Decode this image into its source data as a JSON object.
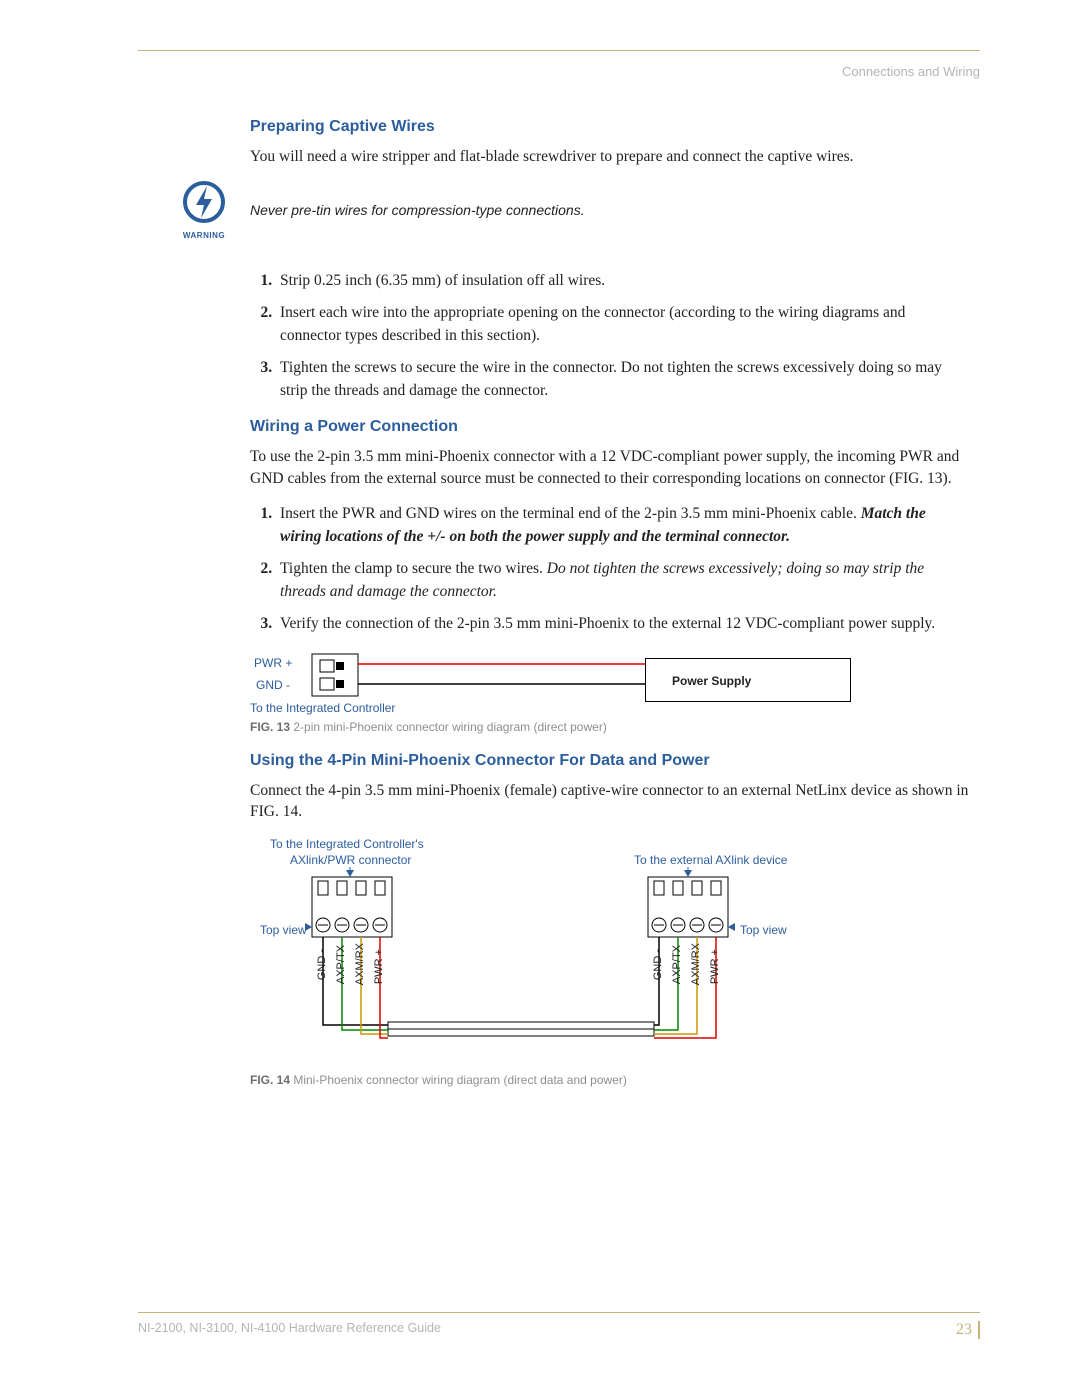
{
  "header": {
    "section": "Connections and Wiring"
  },
  "s1": {
    "title": "Preparing Captive Wires",
    "intro": "You will need a wire stripper and flat-blade screwdriver to prepare and connect the captive wires.",
    "warning_label": "WARNING",
    "warning_text": "Never pre-tin wires for compression-type connections.",
    "step1": "Strip 0.25 inch (6.35 mm) of insulation off all wires.",
    "step2": "Insert each wire into the appropriate opening on the connector (according to the wiring diagrams and connector types described in this section).",
    "step3": "Tighten the screws to secure the wire in the connector. Do not tighten the screws excessively doing so may strip the threads and damage the connector."
  },
  "s2": {
    "title": "Wiring a Power Connection",
    "intro": "To use the 2-pin 3.5 mm mini-Phoenix connector with a 12 VDC-compliant power supply, the incoming PWR and GND cables from the external source must be connected to their corresponding locations on connector (FIG. 13).",
    "step1a": "Insert the PWR and GND wires on the terminal end of the 2-pin 3.5 mm mini-Phoenix cable. ",
    "step1b": "Match the wiring locations of the +/- on both the power supply and the terminal connector.",
    "step2a": "Tighten the clamp to secure the two wires. ",
    "step2b": "Do not tighten the screws excessively; doing so may strip the threads and damage the connector.",
    "step3": "Verify the connection of the 2-pin 3.5 mm mini-Phoenix to the external 12 VDC-compliant power supply."
  },
  "fig13": {
    "pwr": "PWR +",
    "gnd": "GND -",
    "to_ctl": "To the Integrated Controller",
    "ps": "Power Supply",
    "caption_bold": "FIG. 13",
    "caption_rest": "  2-pin mini-Phoenix connector wiring diagram (direct power)"
  },
  "s3": {
    "title": "Using the 4-Pin Mini-Phoenix Connector For Data and Power",
    "intro": "Connect the 4-pin 3.5 mm mini-Phoenix (female) captive-wire connector to an external NetLinx device as shown in FIG. 14."
  },
  "fig14": {
    "to_ctl_l1": "To the Integrated Controller's",
    "to_ctl_l2": "AXlink/PWR connector",
    "to_ext": "To the external AXlink device",
    "topview": "Top view",
    "gnd": "GND -",
    "axptx": "AXP/TX",
    "axmrx": "AXM/RX",
    "pwr": "PWR +",
    "caption_bold": "FIG. 14",
    "caption_rest": "  Mini-Phoenix connector wiring diagram (direct data and power)"
  },
  "footer": {
    "guide": "NI-2100, NI-3100, NI-4100 Hardware Reference Guide",
    "page": "23"
  }
}
